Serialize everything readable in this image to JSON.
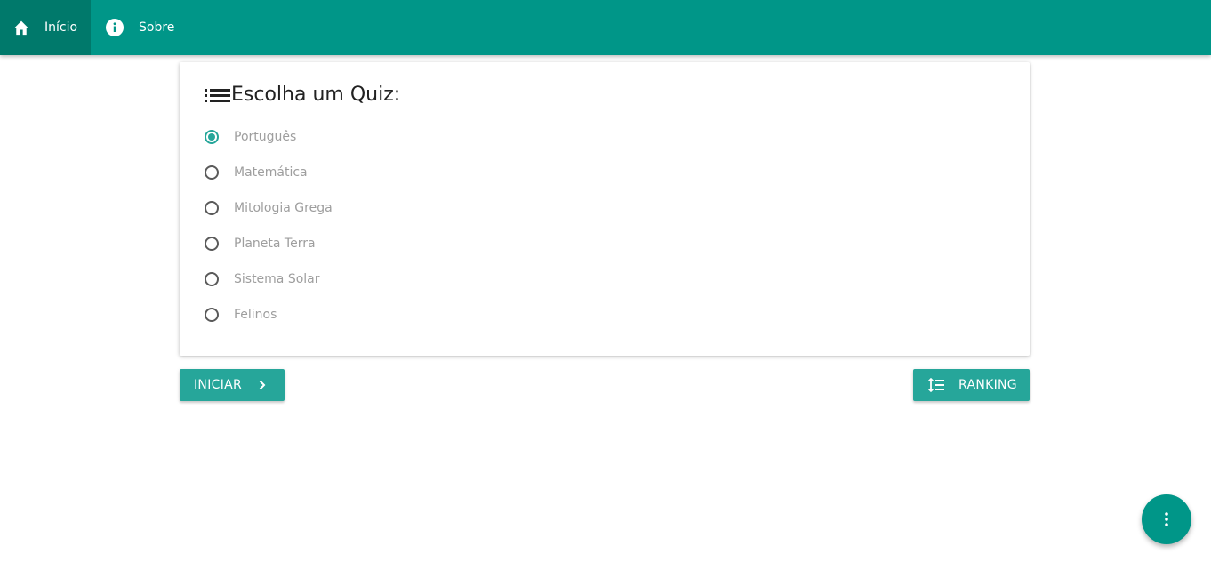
{
  "nav": {
    "items": [
      {
        "label": "Início",
        "icon": "home-icon",
        "active": true
      },
      {
        "label": "Sobre",
        "icon": "info-icon",
        "active": false
      }
    ]
  },
  "quiz": {
    "title": "Escolha um Quiz:",
    "title_icon": "list-icon",
    "options": [
      {
        "label": "Português",
        "checked": true
      },
      {
        "label": "Matemática",
        "checked": false
      },
      {
        "label": "Mitologia Grega",
        "checked": false
      },
      {
        "label": "Planeta Terra",
        "checked": false
      },
      {
        "label": "Sistema Solar",
        "checked": false
      },
      {
        "label": "Felinos",
        "checked": false
      }
    ]
  },
  "actions": {
    "start_label": "INICIAR",
    "start_icon": "chevron-right-icon",
    "ranking_label": "RANKING",
    "ranking_icon": "sort-list-icon"
  },
  "fab": {
    "icon": "more-vert-icon"
  },
  "colors": {
    "primary": "#009688",
    "primary_dark": "#00796b",
    "accent": "#26a69a"
  }
}
